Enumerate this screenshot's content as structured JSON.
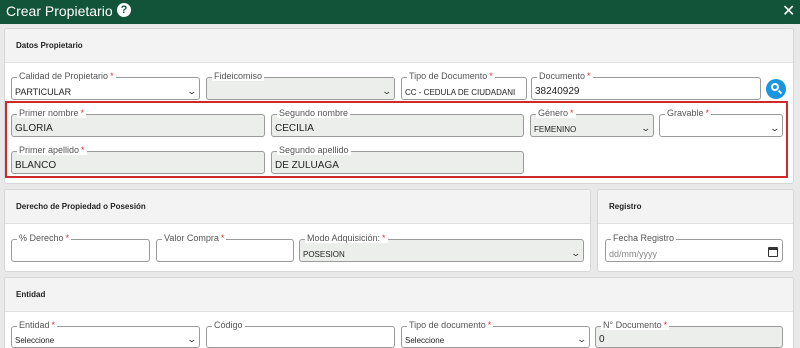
{
  "window": {
    "title": "Crear Propietario",
    "help_icon": "?",
    "close_icon": "✕"
  },
  "datos_propietario": {
    "heading": "Datos Propietario",
    "calidad": {
      "label": "Calidad de Propietario",
      "value": "PARTICULAR"
    },
    "fideicomiso": {
      "label": "Fideicomiso",
      "value": ""
    },
    "tipo_documento": {
      "label": "Tipo de Documento",
      "value": "CC - CEDULA DE CIUDADANI"
    },
    "documento": {
      "label": "Documento",
      "value": "38240929"
    },
    "primer_nombre": {
      "label": "Primer nombre",
      "value": "GLORIA"
    },
    "segundo_nombre": {
      "label": "Segundo nombre",
      "value": "CECILIA"
    },
    "genero": {
      "label": "Género",
      "value": "FEMENINO"
    },
    "gravable": {
      "label": "Gravable",
      "value": ""
    },
    "primer_apellido": {
      "label": "Primer apellido",
      "value": "BLANCO"
    },
    "segundo_apellido": {
      "label": "Segundo apellido",
      "value": "DE ZULUAGA"
    }
  },
  "derecho": {
    "heading": "Derecho de Propiedad o Posesión",
    "porc_derecho": {
      "label": "% Derecho",
      "value": ""
    },
    "valor_compra": {
      "label": "Valor Compra",
      "value": ""
    },
    "modo_adquisicion": {
      "label": "Modo Adquisición:",
      "value": "POSESION"
    }
  },
  "registro": {
    "heading": "Registro",
    "fecha_registro": {
      "label": "Fecha Registro",
      "placeholder": "dd/mm/yyyy"
    }
  },
  "entidad": {
    "heading": "Entidad",
    "entidad": {
      "label": "Entidad",
      "value": "Seleccione"
    },
    "codigo": {
      "label": "Código",
      "value": ""
    },
    "tipo_documento": {
      "label": "Tipo de documento",
      "value": "Seleccione"
    },
    "numero_documento": {
      "label": "N° Documento",
      "value": "0"
    }
  },
  "required_mark": "*",
  "accent_colors": {
    "header": "#12543a",
    "search_button": "#1b95de",
    "highlight": "#d0292c",
    "required": "#dd3333"
  }
}
